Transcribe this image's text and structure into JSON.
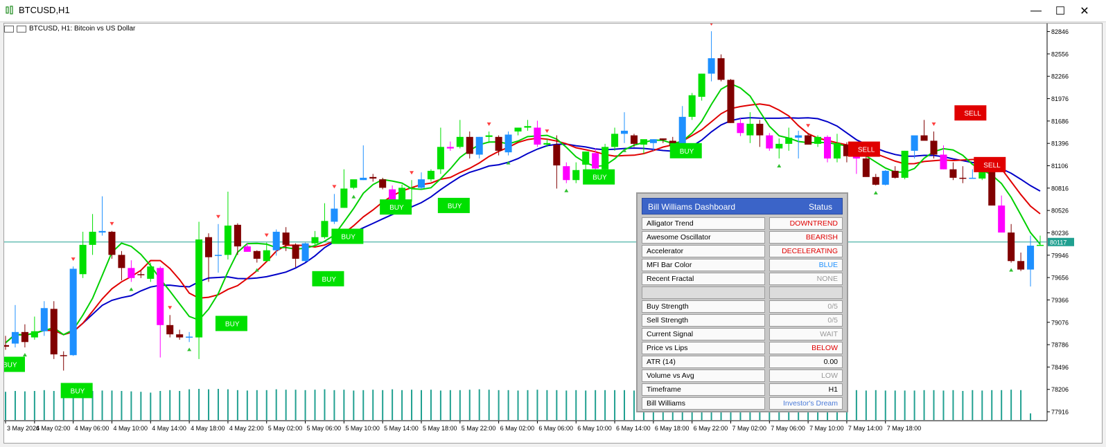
{
  "window": {
    "title": "BTCUSD,H1",
    "min_glyph": "—",
    "max_glyph": "☐",
    "close_glyph": "✕"
  },
  "chart": {
    "symbol_header": "BTCUSD, H1:  Bitcoin vs US Dollar",
    "current_price_label": "80117",
    "colors": {
      "bull": "#00e000",
      "bull_alt": "#1e90ff",
      "bear": "#800000",
      "bear_alt": "#ff00ff",
      "jaw": "#0000c8",
      "teeth": "#e00000",
      "lips": "#00d000",
      "volume": "#20a090",
      "price_line": "#20a090"
    },
    "y_axis_labels": [
      "82846",
      "82556",
      "82266",
      "81976",
      "81686",
      "81396",
      "81106",
      "80816",
      "80526",
      "80236",
      "79946",
      "79656",
      "79366",
      "79076",
      "78786",
      "78496",
      "78206",
      "77916"
    ],
    "x_axis_labels": [
      "3 May 2026",
      "4 May 02:00",
      "4 May 06:00",
      "4 May 10:00",
      "4 May 14:00",
      "4 May 18:00",
      "4 May 22:00",
      "5 May 02:00",
      "5 May 06:00",
      "5 May 10:00",
      "5 May 14:00",
      "5 May 18:00",
      "5 May 22:00",
      "6 May 02:00",
      "6 May 06:00",
      "6 May 10:00",
      "6 May 14:00",
      "6 May 18:00",
      "6 May 22:00",
      "7 May 02:00",
      "7 May 06:00",
      "7 May 10:00",
      "7 May 14:00",
      "7 May 18:00"
    ],
    "signal_labels": {
      "buy": "BUY",
      "sell": "SELL"
    }
  },
  "chart_data": {
    "type": "candlestick",
    "symbol": "BTCUSD",
    "timeframe": "H1",
    "current_price": 80117,
    "ylim": [
      77800,
      82950
    ],
    "candles": [
      [
        78780,
        78900,
        78720,
        78760
      ],
      [
        78800,
        79300,
        78750,
        78950
      ],
      [
        78950,
        79050,
        78750,
        78820
      ],
      [
        78880,
        79150,
        78850,
        78960
      ],
      [
        78960,
        79350,
        78900,
        79260
      ],
      [
        79250,
        79350,
        78600,
        78660
      ],
      [
        78650,
        78700,
        78450,
        78640
      ],
      [
        78650,
        79800,
        78640,
        79770
      ],
      [
        79700,
        80250,
        79650,
        80080
      ],
      [
        80080,
        80480,
        79950,
        80250
      ],
      [
        80240,
        80710,
        80200,
        80260
      ],
      [
        80250,
        80260,
        79900,
        79950
      ],
      [
        79950,
        80000,
        79620,
        79780
      ],
      [
        79780,
        79880,
        79600,
        79650
      ],
      [
        79700,
        79750,
        79650,
        79690
      ],
      [
        79640,
        79850,
        79600,
        79800
      ],
      [
        79780,
        79800,
        78620,
        79040
      ],
      [
        79040,
        79170,
        78880,
        78920
      ],
      [
        78920,
        78980,
        78850,
        78880
      ],
      [
        78880,
        78950,
        78820,
        78890
      ],
      [
        78880,
        80380,
        78600,
        80150
      ],
      [
        80180,
        80230,
        79600,
        79920
      ],
      [
        79950,
        80350,
        79720,
        79950
      ],
      [
        79950,
        80770,
        79890,
        80330
      ],
      [
        80340,
        80360,
        79950,
        80060
      ],
      [
        80060,
        80100,
        79990,
        79990
      ],
      [
        80000,
        80010,
        79850,
        79900
      ],
      [
        79870,
        80110,
        79860,
        80010
      ],
      [
        80010,
        80280,
        79940,
        80250
      ],
      [
        80240,
        80310,
        80000,
        80080
      ],
      [
        80080,
        80100,
        79790,
        79900
      ],
      [
        79870,
        80110,
        79860,
        80100
      ],
      [
        80100,
        80260,
        80060,
        80180
      ],
      [
        80180,
        80620,
        80160,
        80390
      ],
      [
        80380,
        80740,
        80350,
        80550
      ],
      [
        80560,
        81060,
        80560,
        80810
      ],
      [
        80820,
        80910,
        80800,
        80930
      ],
      [
        80920,
        81370,
        80920,
        80950
      ],
      [
        80960,
        81000,
        80900,
        80940
      ],
      [
        80930,
        80950,
        80800,
        80820
      ],
      [
        80800,
        80850,
        80580,
        80600
      ],
      [
        80620,
        80860,
        80580,
        80820
      ],
      [
        80820,
        80920,
        80640,
        80820
      ],
      [
        80820,
        81020,
        80800,
        80930
      ],
      [
        80930,
        81060,
        80900,
        81040
      ],
      [
        81060,
        81600,
        81000,
        81350
      ],
      [
        81350,
        81420,
        81300,
        81330
      ],
      [
        81350,
        81700,
        81330,
        81480
      ],
      [
        81480,
        81550,
        81200,
        81260
      ],
      [
        81250,
        81480,
        81200,
        81480
      ],
      [
        81480,
        81550,
        81400,
        81500
      ],
      [
        81480,
        81500,
        81240,
        81300
      ],
      [
        81280,
        81550,
        81240,
        81510
      ],
      [
        81550,
        81600,
        81500,
        81600
      ],
      [
        81600,
        81700,
        81560,
        81620
      ],
      [
        81600,
        81690,
        81350,
        81380
      ],
      [
        81380,
        81460,
        81350,
        81400
      ],
      [
        81380,
        81500,
        80810,
        81110
      ],
      [
        81100,
        81150,
        80880,
        80920
      ],
      [
        80920,
        81150,
        80880,
        81050
      ],
      [
        81120,
        81270,
        81000,
        81290
      ],
      [
        81270,
        81330,
        81000,
        81070
      ],
      [
        81060,
        81390,
        81040,
        81350
      ],
      [
        81350,
        81600,
        81300,
        81520
      ],
      [
        81520,
        81800,
        81400,
        81560
      ],
      [
        81500,
        81520,
        81350,
        81390
      ],
      [
        81380,
        81420,
        81260,
        81450
      ],
      [
        81400,
        81440,
        81300,
        81450
      ],
      [
        81460,
        81460,
        81400,
        81440
      ],
      [
        81430,
        81480,
        81300,
        81360
      ],
      [
        81360,
        81880,
        81300,
        81740
      ],
      [
        81740,
        82050,
        81700,
        82020
      ],
      [
        82000,
        82300,
        81950,
        82300
      ],
      [
        82300,
        82850,
        82200,
        82500
      ],
      [
        82500,
        82550,
        82200,
        82220
      ],
      [
        82220,
        82230,
        81660,
        81660
      ],
      [
        81660,
        81720,
        81490,
        81530
      ],
      [
        81500,
        81800,
        81400,
        81650
      ],
      [
        81650,
        81700,
        81350,
        81500
      ],
      [
        81500,
        81530,
        81300,
        81330
      ],
      [
        81330,
        81460,
        81200,
        81390
      ],
      [
        81390,
        81600,
        81300,
        81470
      ],
      [
        81470,
        81560,
        81200,
        81500
      ],
      [
        81500,
        81530,
        81380,
        81380
      ],
      [
        81390,
        81500,
        81350,
        81480
      ],
      [
        81480,
        81500,
        81150,
        81200
      ],
      [
        81200,
        81520,
        81150,
        81400
      ],
      [
        81380,
        81410,
        81150,
        81230
      ],
      [
        81230,
        81250,
        81000,
        81200
      ],
      [
        81200,
        81230,
        80980,
        80960
      ],
      [
        80960,
        81000,
        80850,
        80860
      ],
      [
        80860,
        81050,
        80850,
        81040
      ],
      [
        81040,
        81100,
        80940,
        80950
      ],
      [
        80950,
        81300,
        80930,
        81300
      ],
      [
        81300,
        81480,
        81200,
        81500
      ],
      [
        81500,
        81700,
        81480,
        81430
      ],
      [
        81430,
        81550,
        81200,
        81250
      ],
      [
        81250,
        81370,
        81060,
        81060
      ],
      [
        81060,
        81150,
        80920,
        80950
      ],
      [
        80950,
        81100,
        80880,
        80940
      ],
      [
        80940,
        81060,
        80940,
        80950
      ],
      [
        80940,
        81120,
        80920,
        81180
      ],
      [
        81180,
        81180,
        80590,
        80590
      ],
      [
        80590,
        80720,
        80240,
        80240
      ],
      [
        80240,
        80350,
        79850,
        79870
      ],
      [
        79870,
        79980,
        79740,
        79760
      ],
      [
        79760,
        80200,
        79540,
        80070
      ],
      [
        80070,
        80200,
        80070,
        80080
      ]
    ],
    "volume_relative": [
      0.68,
      0.7,
      0.69,
      0.7,
      0.72,
      0.7,
      0.71,
      0.7,
      0.72,
      0.7,
      0.71,
      0.71,
      0.7,
      0.69,
      0.68,
      0.66,
      0.7,
      0.72,
      0.7,
      0.74,
      0.75,
      0.74,
      0.75,
      0.74,
      0.72,
      0.71,
      0.72,
      0.72,
      0.74,
      0.73,
      0.73,
      0.72,
      0.73,
      0.74,
      0.72,
      0.73,
      0.71,
      0.72,
      0.73,
      0.72,
      0.74,
      0.72,
      0.73,
      0.72,
      0.73,
      0.71,
      0.72,
      0.72,
      0.73,
      0.74,
      0.73,
      0.72,
      0.72,
      0.71,
      0.72,
      0.73,
      0.72,
      0.72,
      0.71,
      0.72,
      0.71,
      0.72,
      0.72,
      0.72,
      0.72,
      0.71,
      0.72,
      0.71,
      0.71,
      0.72,
      0.73,
      0.72,
      0.74,
      0.74,
      0.75,
      0.73,
      0.73,
      0.72,
      0.73,
      0.72,
      0.72,
      0.71,
      0.72,
      0.71,
      0.71,
      0.72,
      0.72,
      0.71,
      0.72,
      0.71,
      0.72,
      0.71,
      0.71,
      0.71,
      0.71,
      0.72,
      0.72,
      0.71,
      0.72,
      0.7,
      0.72,
      0.71,
      0.72,
      0.72,
      0.73,
      0.72,
      0.16
    ]
  },
  "dashboard": {
    "title": "Bill Williams Dashboard",
    "status_header": "Status",
    "rows": [
      {
        "label": "Alligator Trend",
        "value": "DOWNTREND",
        "color": "#e00000"
      },
      {
        "label": "Awesome Oscillator",
        "value": "BEARISH",
        "color": "#e00000"
      },
      {
        "label": "Accelerator",
        "value": "DECELERATING",
        "color": "#e00000"
      },
      {
        "label": "MFI Bar Color",
        "value": "BLUE",
        "color": "#1e90ff"
      },
      {
        "label": "Recent Fractal",
        "value": "NONE",
        "color": "#999999"
      },
      {
        "label": "",
        "value": "",
        "color": "#000000"
      },
      {
        "label": "Buy Strength",
        "value": "0/5",
        "color": "#999999"
      },
      {
        "label": "Sell Strength",
        "value": "0/5",
        "color": "#999999"
      },
      {
        "label": "Current Signal",
        "value": "WAIT",
        "color": "#999999"
      },
      {
        "label": "Price vs Lips",
        "value": "BELOW",
        "color": "#e00000"
      },
      {
        "label": "ATR (14)",
        "value": "0.00",
        "color": "#000000"
      },
      {
        "label": "Volume vs Avg",
        "value": "LOW",
        "color": "#999999"
      },
      {
        "label": "Timeframe",
        "value": "H1",
        "color": "#000000"
      },
      {
        "label": "Bill Williams",
        "value": "Investor's Dream",
        "color": "#4a7ad8"
      }
    ]
  }
}
